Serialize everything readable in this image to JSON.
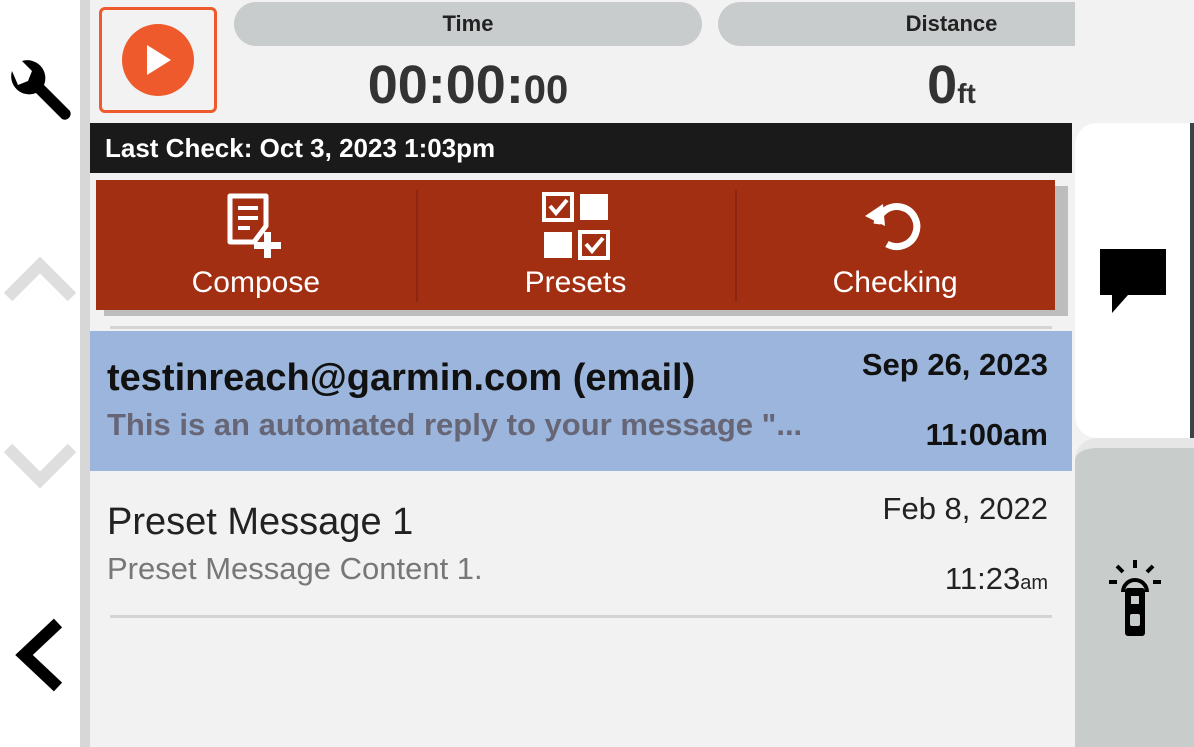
{
  "stats": {
    "time_label": "Time",
    "time_main": "00:00:",
    "time_small": "00",
    "distance_label": "Distance",
    "distance_value": "0",
    "distance_unit": "ft"
  },
  "last_check": "Last Check: Oct 3, 2023 1:03pm",
  "actions": [
    {
      "label": "Compose",
      "icon": "compose-icon"
    },
    {
      "label": "Presets",
      "icon": "presets-icon"
    },
    {
      "label": "Checking",
      "icon": "refresh-icon"
    }
  ],
  "messages": [
    {
      "title": "testinreach@garmin.com (email)",
      "preview": "This is an automated reply to your message \"...",
      "date": "Sep 26, 2023",
      "time": "11:00am",
      "selected": true
    },
    {
      "title": "Preset Message 1",
      "preview": "Preset Message Content 1.",
      "date": "Feb 8, 2022",
      "time_main": "11:23",
      "time_suffix": "am",
      "selected": false
    }
  ],
  "colors": {
    "accent": "#ee5a2b",
    "action_bar": "#a32f13",
    "selected_row": "#9bb5dc",
    "header_bar": "#1a1a1a"
  }
}
